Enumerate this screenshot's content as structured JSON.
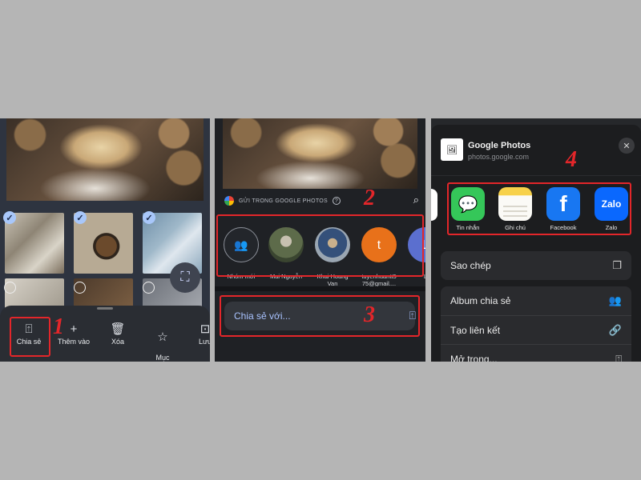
{
  "panel1": {
    "actions": [
      {
        "label": "Chia sẻ",
        "icon": "share-icon"
      },
      {
        "label": "Thêm vào",
        "icon": "plus-icon"
      },
      {
        "label": "Xóa",
        "icon": "trash-icon"
      },
      {
        "label": "Mục\nưa thích",
        "icon": "star-icon"
      },
      {
        "label": "Lưu",
        "icon": "save-icon"
      }
    ],
    "step": "1"
  },
  "panel2": {
    "send_header": "GỬI TRONG GOOGLE PHOTOS",
    "contacts": [
      {
        "name": "Nhóm mới",
        "initial": ""
      },
      {
        "name": "Mai Nguyễn",
        "initial": ""
      },
      {
        "name": "Khai Hoang\nVan",
        "initial": ""
      },
      {
        "name": "tuyenhuantt5\n75@gmail....",
        "initial": "t"
      },
      {
        "name": "L",
        "initial": "L"
      }
    ],
    "share_with": "Chia sẻ với...",
    "step2": "2",
    "step3": "3"
  },
  "panel3": {
    "app_title": "Google Photos",
    "app_url": "photos.google.com",
    "apps": [
      {
        "label": "Tin nhắn",
        "icon": "messages-icon"
      },
      {
        "label": "Ghi chú",
        "icon": "notes-icon"
      },
      {
        "label": "Facebook",
        "icon": "facebook-icon",
        "glyph": "f"
      },
      {
        "label": "Zalo",
        "icon": "zalo-icon",
        "glyph": "Zalo"
      }
    ],
    "copy": "Sao chép",
    "shared_album": "Album chia sẻ",
    "create_link": "Tạo liên kết",
    "open_in": "Mở trong...",
    "step": "4"
  },
  "colors": {
    "highlight": "#e3262a",
    "background": "#b5b5b5"
  }
}
